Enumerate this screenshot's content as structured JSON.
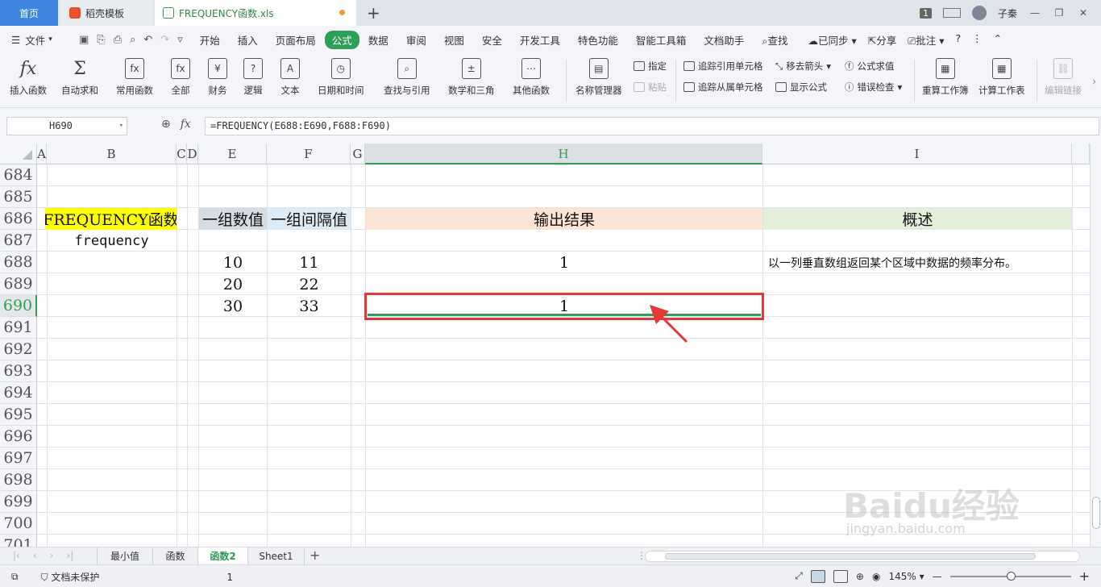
{
  "titlebar": {
    "tabs": [
      "首页",
      "稻壳模板",
      "FREQUENCY函数.xls"
    ],
    "page_count": "1",
    "user": "子秦"
  },
  "menubar": {
    "file_label": "文件",
    "items": [
      "开始",
      "插入",
      "页面布局",
      "公式",
      "数据",
      "审阅",
      "视图",
      "安全",
      "开发工具",
      "特色功能",
      "智能工具箱",
      "文档助手"
    ],
    "active": "公式",
    "search": "查找",
    "sync": "已同步",
    "share": "分享",
    "comment": "批注"
  },
  "ribbon": {
    "big_buttons": [
      "插入函数",
      "自动求和",
      "常用函数",
      "全部",
      "财务",
      "逻辑",
      "文本",
      "日期和时间",
      "查找与引用",
      "数学和三角",
      "其他函数",
      "名称管理器"
    ],
    "define": "指定",
    "paste": "粘贴",
    "trace_precedents": "追踪引用单元格",
    "trace_dependents": "追踪从属单元格",
    "remove_arrows": "移去箭头",
    "show_formulas": "显示公式",
    "evaluate": "公式求值",
    "error_check": "错误检查",
    "recalc_book": "重算工作簿",
    "recalc_sheet": "计算工作表",
    "edit_links": "编辑链接"
  },
  "formula_bar": {
    "name_box": "H690",
    "fx_label": "fx",
    "formula": "=FREQUENCY(E688:E690,F688:F690)"
  },
  "columns": [
    "A",
    "B",
    "C",
    "D",
    "E",
    "F",
    "G",
    "H",
    "I"
  ],
  "rows": [
    "684",
    "685",
    "686",
    "687",
    "688",
    "689",
    "690",
    "691",
    "692",
    "693",
    "694",
    "695",
    "696",
    "697",
    "698",
    "699",
    "700",
    "701"
  ],
  "cells": {
    "B686": "FREQUENCY函数",
    "B687": "frequency",
    "E686": "一组数值",
    "F686": "一组间隔值",
    "H686": "输出结果",
    "I686": "概述",
    "E688": "10",
    "F688": "11",
    "H688": "1",
    "I688": "以一列垂直数组返回某个区域中数据的频率分布。",
    "E689": "20",
    "F689": "22",
    "E690": "30",
    "F690": "33",
    "H690": "1"
  },
  "colors": {
    "B686_fill": "#ffff00",
    "E686_fill": "#d6dce4",
    "F686_fill": "#ddebf7",
    "H686_fill": "#fce4d6",
    "I686_fill": "#e2efda",
    "accent": "#2f9e56",
    "selection_box": "#e53935"
  },
  "sheets": [
    "最小值",
    "函数",
    "函数2",
    "Sheet1"
  ],
  "active_sheet": "函数2",
  "statusbar": {
    "protect": "文档未保护",
    "count": "1",
    "zoom": "145%"
  },
  "watermark": {
    "logo": "Baidu经验",
    "url": "jingyan.baidu.com"
  }
}
